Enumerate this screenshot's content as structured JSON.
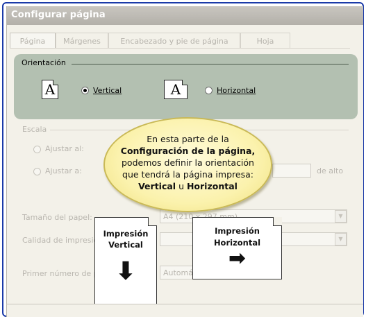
{
  "window": {
    "title": "Configurar página"
  },
  "tabs": [
    {
      "label": "Página",
      "active": true
    },
    {
      "label": "Márgenes",
      "active": false
    },
    {
      "label": "Encabezado y pie de página",
      "active": false
    },
    {
      "label": "Hoja",
      "active": false
    }
  ],
  "orientation": {
    "group_label": "Orientación",
    "vertical_label": "Vertical",
    "horizontal_label": "Horizontal",
    "selected": "vertical",
    "icon_letter": "A"
  },
  "scale": {
    "group_label": "Escala",
    "adjust_to": "Ajustar al:",
    "adjust_fit": "Ajustar a:",
    "tall_suffix": "de alto"
  },
  "paper_size": {
    "label": "Tamaño del papel:",
    "value": "A4 (210 x 297 mm)"
  },
  "print_quality": {
    "label": "Calidad de impresión:",
    "value": ""
  },
  "first_page": {
    "label": "Primer número de página:",
    "value": "Automático"
  },
  "callout": {
    "line1": "En esta parte de la",
    "line2": "Configuración de la página,",
    "line3": "podemos definir la orientación",
    "line4": "que tendrá la página impresa:",
    "line5_a": "Vertical",
    "line5_b": " u ",
    "line5_c": "Horizontal"
  },
  "illustration": {
    "vertical_title_1": "Impresión",
    "vertical_title_2": "Vertical",
    "horizontal_title_1": "Impresión",
    "horizontal_title_2": "Horizontal",
    "arrow_down": "⬇",
    "arrow_right": "➡"
  },
  "colors": {
    "frame": "#1a3aa8",
    "highlight_box": "#b3c0b1",
    "bubble": "#fbf2ad",
    "dialog_bg": "#f3f1e9"
  }
}
